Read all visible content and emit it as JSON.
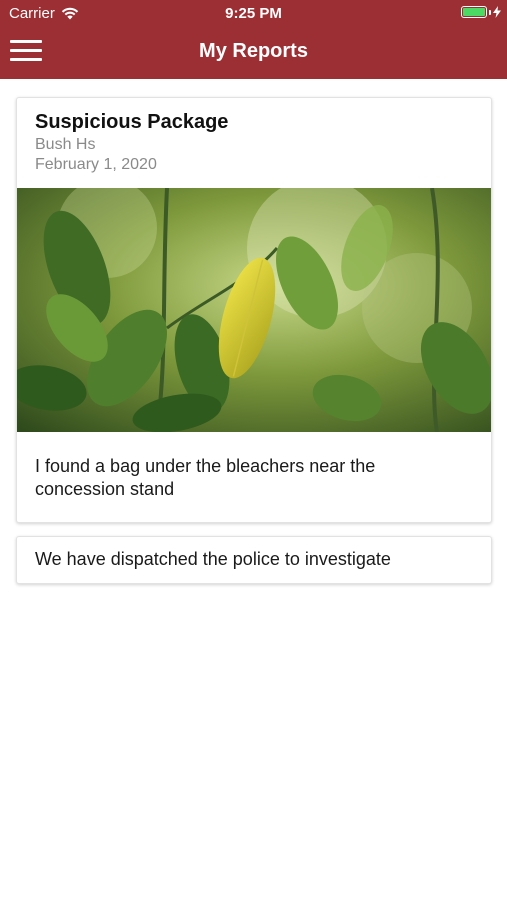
{
  "status_bar": {
    "carrier": "Carrier",
    "time": "9:25 PM",
    "wifi_icon": "wifi-icon",
    "battery_icon": "battery-charging-icon",
    "battery_color": "#4cd964"
  },
  "nav": {
    "title": "My Reports",
    "menu_icon": "hamburger-menu-icon",
    "background_color": "#9c2f33"
  },
  "report": {
    "title": "Suspicious Package",
    "location": "Bush Hs",
    "date": "February 1, 2020",
    "photo": "photo of green leaves with a single yellow leaf",
    "description": "I found a bag under the bleachers near the concession stand"
  },
  "response": {
    "text": "We have dispatched the police to investigate"
  }
}
